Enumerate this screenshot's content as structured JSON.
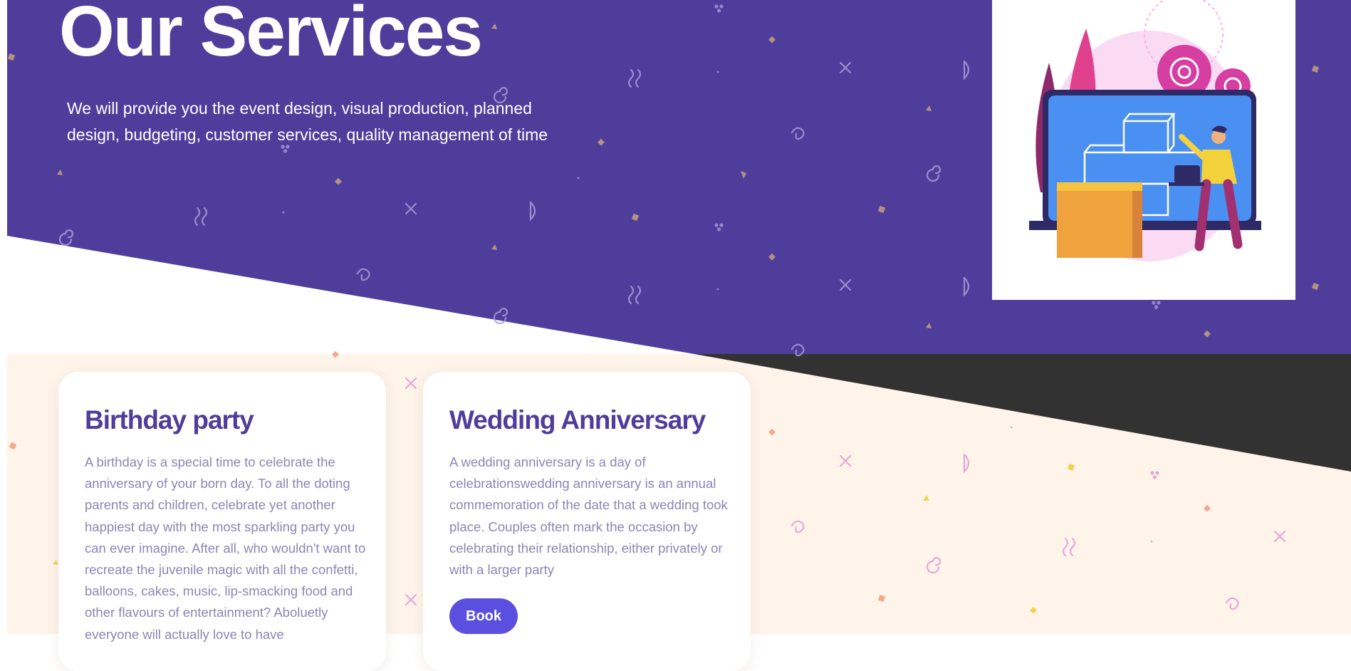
{
  "colors": {
    "hero_bg": "#4f3d9b",
    "section_bg": "#fef4ea",
    "dark_band": "#323232",
    "card_title": "#4f3d9b",
    "card_text": "#8c86b3",
    "button": "#5b4fe0"
  },
  "hero": {
    "title": "Our Services",
    "subtitle": "We will provide you the event design, visual production, planned design, budgeting, customer services, quality management of time"
  },
  "illustration": {
    "icon": "laptop-presentation-illustration"
  },
  "services": [
    {
      "title": "Birthday party",
      "description": "A birthday is a special time to celebrate the anniversary of your born day. To all the doting parents and children, celebrate yet another happiest day with the most sparkling party you can ever imagine. After all, who wouldn't want to recreate the juvenile magic with all the confetti, balloons, cakes, music, lip-smacking food and other flavours of entertainment? Aboluetly everyone will actually love to have"
    },
    {
      "title": "Wedding Anniversary",
      "description": "A wedding anniversary is a day of celebrationswedding anniversary is an annual commemoration of the date that a wedding took place. Couples often mark the occasion by celebrating their relationship, either privately or with a larger party",
      "button_label": "Book"
    }
  ]
}
